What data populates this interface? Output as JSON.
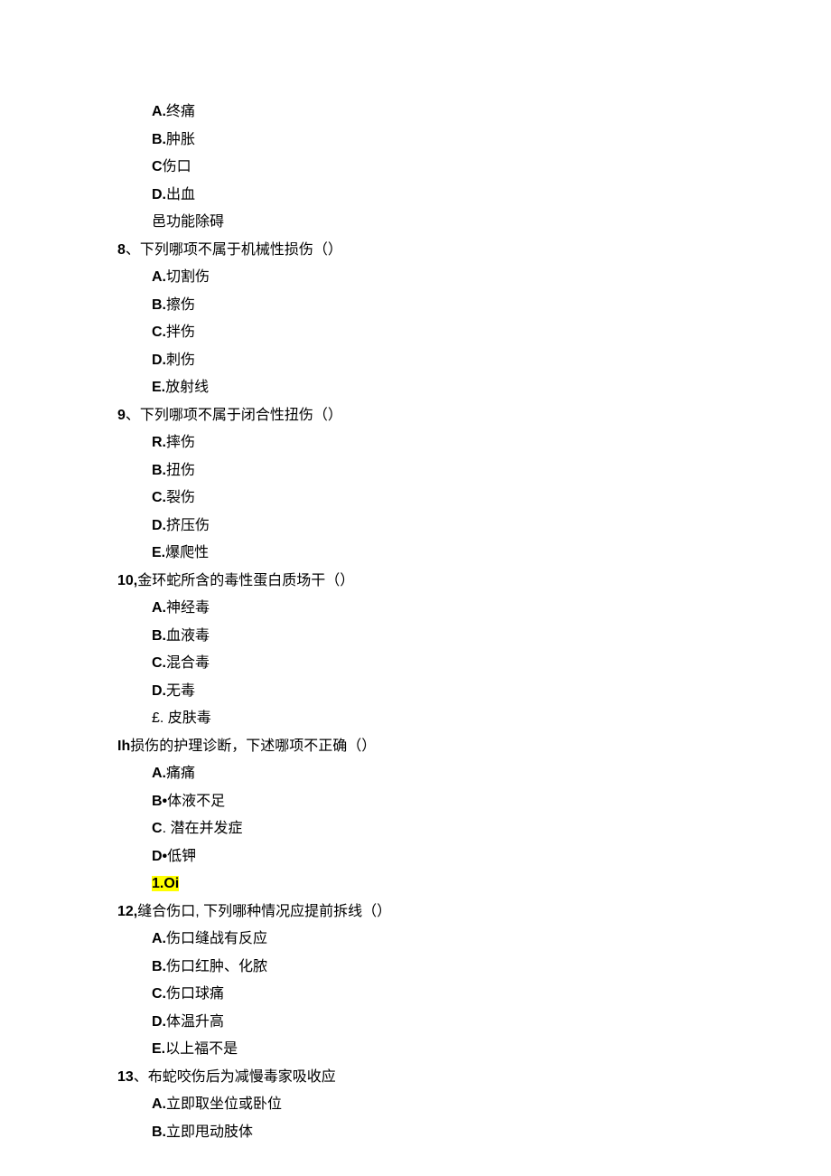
{
  "q7": {
    "optA_prefix": "A.",
    "optA_text": "终痛",
    "optB_prefix": "B.",
    "optB_text": "肿胀",
    "optC_prefix": "C",
    "optC_text": "伤口",
    "optD_prefix": "D.",
    "optD_text": "出血",
    "optE_text": "邑功能除碍"
  },
  "q8": {
    "num": "8",
    "stem": "、下列哪项不属于机械性损伤（）",
    "optA_prefix": "A.",
    "optA_text": "切割伤",
    "optB_prefix": "B.",
    "optB_text": "擦伤",
    "optC_prefix": "C.",
    "optC_text": "拌伤",
    "optD_prefix": "D.",
    "optD_text": "刺伤",
    "optE_prefix": "E.",
    "optE_text": "放射线"
  },
  "q9": {
    "num": "9",
    "stem": "、下列哪项不属于闭合性扭伤（）",
    "optA_prefix": "R.",
    "optA_text": "摔伤",
    "optB_prefix": "B.",
    "optB_text": "扭伤",
    "optC_prefix": "C.",
    "optC_text": "裂伤",
    "optD_prefix": "D.",
    "optD_text": "挤压伤",
    "optE_prefix": "E.",
    "optE_text": "爆爬性"
  },
  "q10": {
    "num": "10,",
    "stem": "金环蛇所含的毒性蛋白质场干（）",
    "optA_prefix": "A.",
    "optA_text": "神经毒",
    "optB_prefix": "B.",
    "optB_text": "血液毒",
    "optC_prefix": "C.",
    "optC_text": "混合毒",
    "optD_prefix": "D.",
    "optD_text": "无毒",
    "optE_prefix": "£.",
    "optE_text": " 皮肤毒"
  },
  "q11": {
    "num": "Ih",
    "stem": "损伤的护理诊断，下述哪项不正确（）",
    "optA_prefix": "A.",
    "optA_text": "痛痛",
    "optB_prefix": "B•",
    "optB_text": "体液不足",
    "optC_prefix": "C",
    "optC_text": ". 潜在并发症",
    "optD_prefix": "D•",
    "optD_text": "低钾",
    "optE_prefix": "1.Oi"
  },
  "q12": {
    "num": "12,",
    "stem": "缝合伤口, 下列哪种情况应提前拆线（）",
    "optA_prefix": "A.",
    "optA_text": "伤口缝战有反应",
    "optB_prefix": "B.",
    "optB_text": "伤口红肿、化脓",
    "optC_prefix": "C.",
    "optC_text": "伤口球痛",
    "optD_prefix": "D.",
    "optD_text": "体温升高",
    "optE_prefix": "E.",
    "optE_text": "以上福不是"
  },
  "q13": {
    "num": "13",
    "stem": "、布蛇咬伤后为减慢毒家吸收应",
    "optA_prefix": "A.",
    "optA_text": "立即取坐位或卧位",
    "optB_prefix": "B.",
    "optB_text": "立即甩动肢体"
  }
}
